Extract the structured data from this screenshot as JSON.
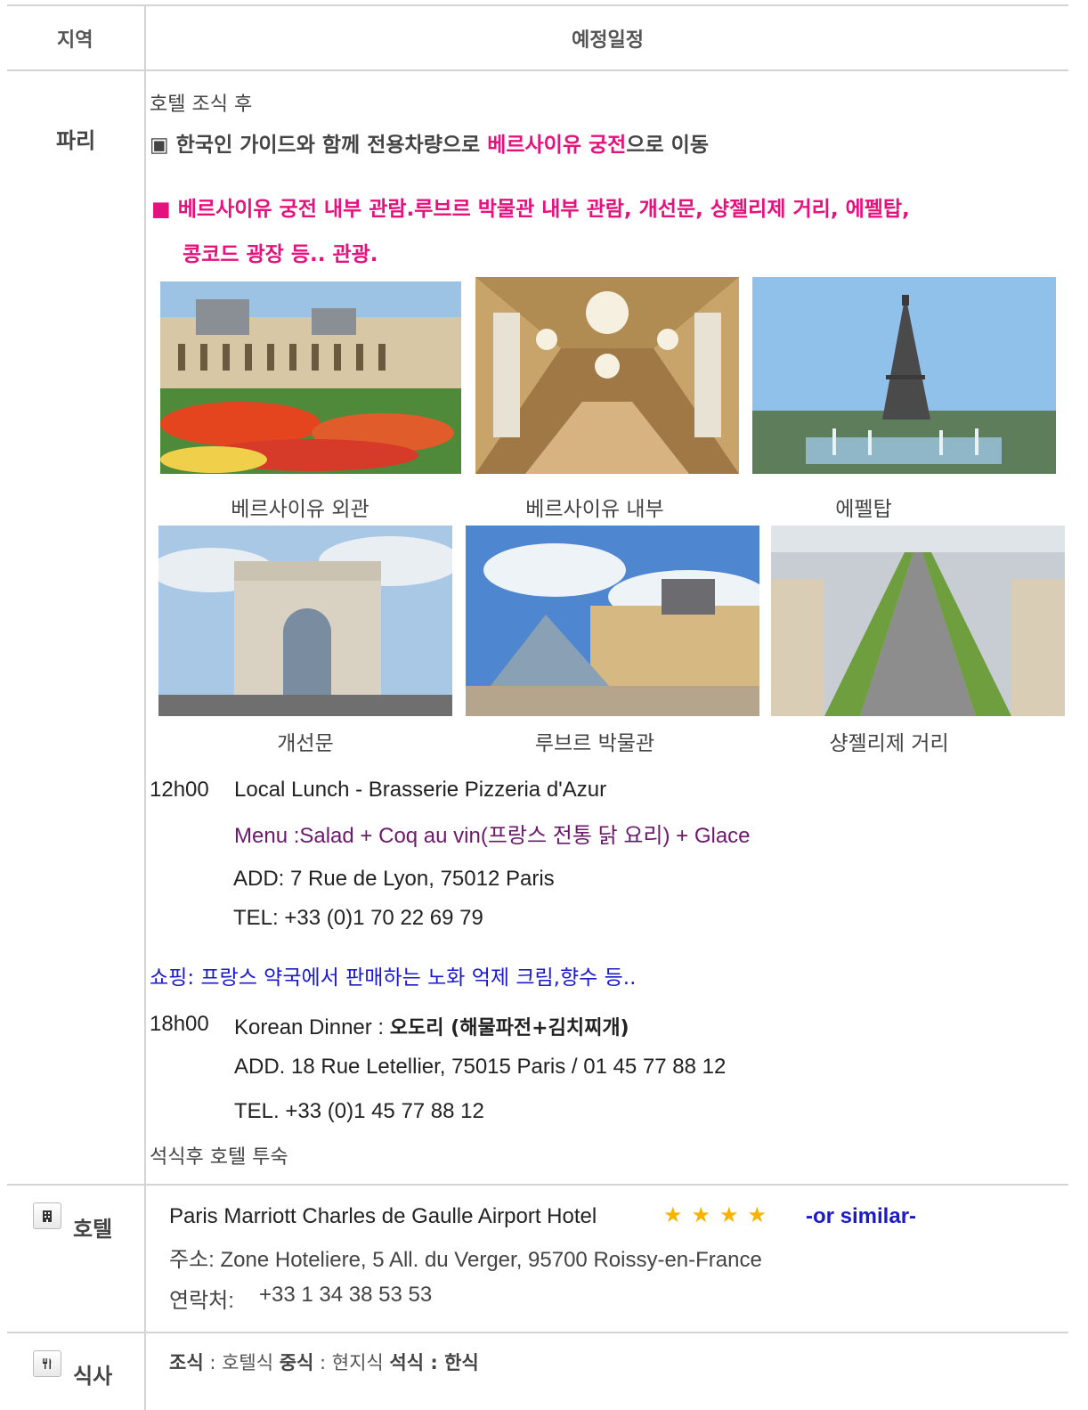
{
  "header": {
    "col_region": "지역",
    "col_schedule": "예정일정"
  },
  "day": {
    "region": "파리",
    "intro": "호텔 조식 후",
    "transfer": {
      "bullet": "▣",
      "pre": "한국인 가이드와 함께 전용차량으로 ",
      "highlight": "베르사이유 궁전",
      "post": "으로 이동"
    },
    "sights": {
      "bullet": "■",
      "line1": "베르사이유 궁전 내부 관람.루브르 박물관 내부 관람, 개선문, 샹젤리제 거리, 에펠탑,",
      "line2": "콩코드 광장 등.. 관광."
    },
    "photos_row1": [
      {
        "caption": "베르사이유 외관",
        "icon": "palace-exterior-photo"
      },
      {
        "caption": "베르사이유 내부",
        "icon": "hall-of-mirrors-photo"
      },
      {
        "caption": "에펠탑",
        "icon": "eiffel-tower-photo"
      }
    ],
    "photos_row2": [
      {
        "caption": "개선문",
        "icon": "arc-de-triomphe-photo"
      },
      {
        "caption": "루브르 박물관",
        "icon": "louvre-pyramid-photo"
      },
      {
        "caption": "샹젤리제 거리",
        "icon": "champs-elysees-photo"
      }
    ],
    "lunch": {
      "time": "12h00",
      "title": "Local Lunch - Brasserie Pizzeria d'Azur",
      "menu": "Menu :Salad + Coq au vin(프랑스 전통 닭 요리) + Glace",
      "add": "ADD: 7 Rue de Lyon, 75012 Paris",
      "tel": "TEL: +33 (0)1 70 22 69 79"
    },
    "shopping": "쇼핑: 프랑스 약국에서 판매하는 노화 억제 크림,향수 등..",
    "dinner": {
      "time": "18h00",
      "label": "Korean Dinner : ",
      "name": "오도리 (해물파전+김치찌개)",
      "add": "ADD. 18 Rue Letellier, 75015 Paris / 01 45 77 88 12",
      "tel": "TEL. +33 (0)1 45 77 88 12"
    },
    "closing": "석식후 호텔 투숙"
  },
  "hotel": {
    "icon": "building-icon",
    "label": "호텔",
    "name": "Paris Marriott Charles de Gaulle Airport Hotel",
    "stars": 4,
    "similar": "-or similar-",
    "address": "주소: Zone Hoteliere, 5 All. du Verger, 95700 Roissy-en-France",
    "contact_label": "연락처:",
    "contact": "+33 1 34 38 53 53"
  },
  "meals": {
    "icon": "fork-knife-icon",
    "label": "식사",
    "breakfast_label": "조식",
    "breakfast": " : 호텔식  ",
    "lunch_label": "중식",
    "lunch": " : 현지식  ",
    "dinner_label": "석식 : 한식"
  },
  "colors": {
    "pink": "#e5127d",
    "purple": "#6b1a6b",
    "blue": "#1a1acc",
    "star": "#f5b400",
    "line": "#d4d4d4"
  }
}
